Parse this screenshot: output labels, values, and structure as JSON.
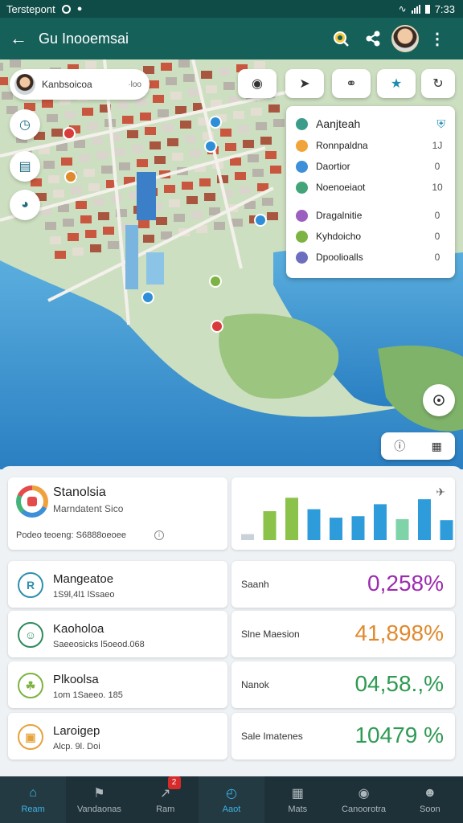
{
  "status_bar": {
    "carrier": "Terstepont",
    "time": "7:33"
  },
  "app_bar": {
    "title": "Gu Inooemsai",
    "back_icon": "arrow-left-icon",
    "search_icon": "search-icon",
    "share_icon": "share-icon",
    "menu_icon": "more-vert-icon"
  },
  "map": {
    "search_chip": {
      "label": "Kanbsoicoa",
      "tail": "·loo"
    },
    "side_buttons": [
      "clock-icon",
      "document-icon",
      "location-icon"
    ],
    "tool_buttons": [
      "layers-toggle-icon",
      "route-icon",
      "shield-icon",
      "star-icon",
      "refresh-icon"
    ],
    "layers": {
      "header": "Aanjteah",
      "rows": [
        {
          "name": "Ronnpaldna",
          "value": "1J",
          "color": "#f0a43a"
        },
        {
          "name": "Daortior",
          "value": "0",
          "color": "#3d8fd8"
        },
        {
          "name": "Noenoeiaot",
          "value": "10",
          "color": "#43a47a"
        },
        {
          "name": "Dragalnitie",
          "value": "0",
          "color": "#9b5fc0"
        },
        {
          "name": "Kyhdoicho",
          "value": "0",
          "color": "#7cb342"
        },
        {
          "name": "Dpoolioalls",
          "value": "0",
          "color": "#6c6fbf"
        }
      ]
    }
  },
  "overview": {
    "title": "Stanolsia",
    "subtitle": "Marndatent Sico",
    "footer": "Podeo teoeng: S6888oeoee"
  },
  "bar_chart": {
    "values": [
      0.12,
      0.58,
      0.85,
      0.62,
      0.45,
      0.48,
      0.72,
      0.42,
      0.82,
      0.4
    ],
    "colors": [
      "#c9d2d8",
      "#8bc34a",
      "#8bc34a",
      "#2e9cdb",
      "#2e9cdb",
      "#2e9cdb",
      "#2e9cdb",
      "#7fd3a8",
      "#2e9cdb",
      "#2e9cdb"
    ]
  },
  "stats": [
    {
      "name": "Mangeatoe",
      "sub": "1S9l,4l1 lSsaeo",
      "icon": "box-icon",
      "color": "#2e8fb0",
      "glyph": "R"
    },
    {
      "name": "Kaoholoa",
      "sub": "Saeeosicks l5oeod.068",
      "icon": "person-icon",
      "color": "#2e8a5c",
      "glyph": "☺"
    },
    {
      "name": "Plkoolsa",
      "sub": "1om 1Saeeo. 185",
      "icon": "tree-icon",
      "color": "#7cb342",
      "glyph": "☘"
    },
    {
      "name": "Laroigep",
      "sub": "Alcp. 9l. Doi",
      "icon": "wallet-icon",
      "color": "#e6a23c",
      "glyph": "▣"
    }
  ],
  "metrics": [
    {
      "label": "Saanh",
      "value": "0,258%",
      "color": "#9c2bb0"
    },
    {
      "label": "Slne Maesion",
      "value": "41,898%",
      "color": "#e08a2e"
    },
    {
      "label": "Nanok",
      "value": "04,58.,%",
      "color": "#2e9a52"
    },
    {
      "label": "Sale Imatenes",
      "value": "10479 %",
      "color": "#2e9a52"
    }
  ],
  "nav": [
    {
      "label": "Ream",
      "icon": "home-icon"
    },
    {
      "label": "Vandaonas",
      "icon": "flag-icon"
    },
    {
      "label": "Ram",
      "icon": "chart-icon",
      "badge": "2"
    },
    {
      "label": "Aaot",
      "icon": "clock-icon"
    },
    {
      "label": "Mats",
      "icon": "calendar-icon"
    },
    {
      "label": "Canoorotra",
      "icon": "camera-icon"
    },
    {
      "label": "Soon",
      "icon": "account-icon"
    }
  ]
}
